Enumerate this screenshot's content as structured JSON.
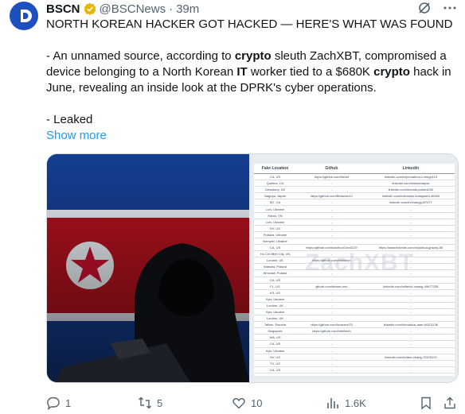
{
  "tweet": {
    "author_name": "BSCN",
    "handle": "@BSCNews",
    "separator": "·",
    "time": "39m",
    "lines": [
      "NORTH KOREAN HACKER GOT HACKED — HERE'S WHAT WAS FOUND"
    ],
    "para2": {
      "t1": "- An unnamed source, according to ",
      "b1": "crypto",
      "t2": " sleuth ZachXBT, compromised a device belonging to a North Korean ",
      "b2": "IT",
      "t3": " worker tied to a $680K ",
      "b3": "crypto",
      "t4": " hack in June, revealing an inside look at the DPRK's cyber operations."
    },
    "para3": "- Leaked",
    "show_more": "Show more"
  },
  "sheet": {
    "headers": [
      "Fake Location",
      "Github",
      "Linkedin"
    ],
    "watermark": "ZachXBT",
    "rows": [
      [
        "CA, US",
        "https://github.com/frenbt",
        "linkedin.com/in/johnathon-h-leng0119"
      ],
      [
        "Quebec, CA",
        "-",
        "linkedin.com/in/davidrapss"
      ],
      [
        "Dewsbury, UK",
        "-",
        "linkedin.com/in/mark-pickles030"
      ],
      [
        "Nagoya, Japan",
        "https://github.com/Belaceto12",
        "linkedin.com/in/kosuke-kobayashi-4b083"
      ],
      [
        "BC, CA",
        "-",
        "linkedin.com/in/zhangyu07477"
      ],
      [
        "Lviv, Ukraine",
        "-",
        "-"
      ],
      [
        "Hanoi, VN",
        "-",
        "-"
      ],
      [
        "Lviv, Ukraine",
        "-",
        "-"
      ],
      [
        "NY, US",
        "-",
        "-"
      ],
      [
        "Poltava, Ukraine",
        "-",
        "-"
      ],
      [
        "Nemyriv, Ukraine",
        "-",
        "-"
      ],
      [
        "CA, US",
        "https://github.com/solutionGuru0129",
        "https://www.linkedin.com/in/joshua-gracey-85"
      ],
      [
        "Ho Chi Minh City, VN",
        "-",
        "-"
      ],
      [
        "London, UK",
        "https://github.com/intelltech",
        "-"
      ],
      [
        "Warsaw, Poland",
        "-",
        "-"
      ],
      [
        "Wroclaw, Poland",
        "-",
        "-"
      ],
      [
        "CA, US",
        "-",
        "-"
      ],
      [
        "FL, US",
        "github.com/blesen-dev",
        "linkedin.com/in/kevin-hwang-49b77335"
      ],
      [
        "KS, US",
        "-",
        "-"
      ],
      [
        "Kyiv, Ukraine",
        "-",
        "-"
      ],
      [
        "London, UK",
        "-",
        "-"
      ],
      [
        "Kyiv, Ukraine",
        "-",
        "-"
      ],
      [
        "London, UK",
        "-",
        "-"
      ],
      [
        "Tallinn, Estonia",
        "https://github.com/lucanero75",
        "linkedin.com/in/markus-laan-b0321136"
      ],
      [
        "Singapore",
        "https://github.com/intelltech",
        "-"
      ],
      [
        "WA, US",
        "-",
        "-"
      ],
      [
        "CA, US",
        "-",
        "-"
      ],
      [
        "Kyiv, Ukraine",
        "-",
        "-"
      ],
      [
        "NV, US",
        "-",
        "linkedin.com/in/abo-zhang-72878110"
      ],
      [
        "TX, US",
        "-",
        "-"
      ],
      [
        "CA, US",
        "-",
        "-"
      ]
    ]
  },
  "actions": {
    "replies": "1",
    "reposts": "5",
    "likes": "10",
    "views": "1.6K"
  },
  "icons": [
    "bscn-logo-icon",
    "verified-badge-icon",
    "grok-icon",
    "more-icon",
    "reply-icon",
    "repost-icon",
    "like-icon",
    "views-icon",
    "bookmark-icon",
    "share-icon"
  ],
  "colors": {
    "accent": "#1d9bf0",
    "muted": "#536471",
    "verified": "#e8b400",
    "avatar": "#1d4fbf"
  }
}
